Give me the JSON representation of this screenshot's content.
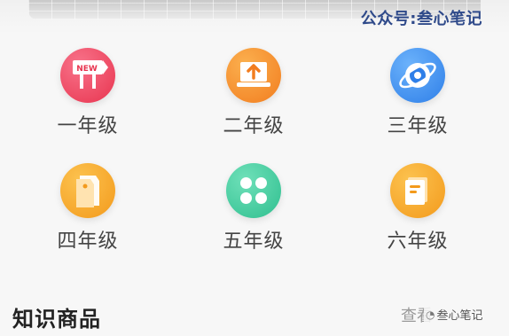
{
  "watermark": {
    "top": "公众号:叁心笔记",
    "bottom": "叁心笔记"
  },
  "grades": [
    {
      "label": "一年级",
      "icon": "new-sign-icon",
      "color": "#ef4563"
    },
    {
      "label": "二年级",
      "icon": "laptop-upload-icon",
      "color": "#f5902c"
    },
    {
      "label": "三年级",
      "icon": "orbit-planet-icon",
      "color": "#3a8ef0"
    },
    {
      "label": "四年级",
      "icon": "price-tag-icon",
      "color": "#f7a72a"
    },
    {
      "label": "五年级",
      "icon": "clover-grid-icon",
      "color": "#3cc99a"
    },
    {
      "label": "六年级",
      "icon": "notes-icon",
      "color": "#f7a72a"
    }
  ],
  "new_badge": "NEW",
  "section": {
    "title": "知识商品",
    "more": "查看"
  }
}
